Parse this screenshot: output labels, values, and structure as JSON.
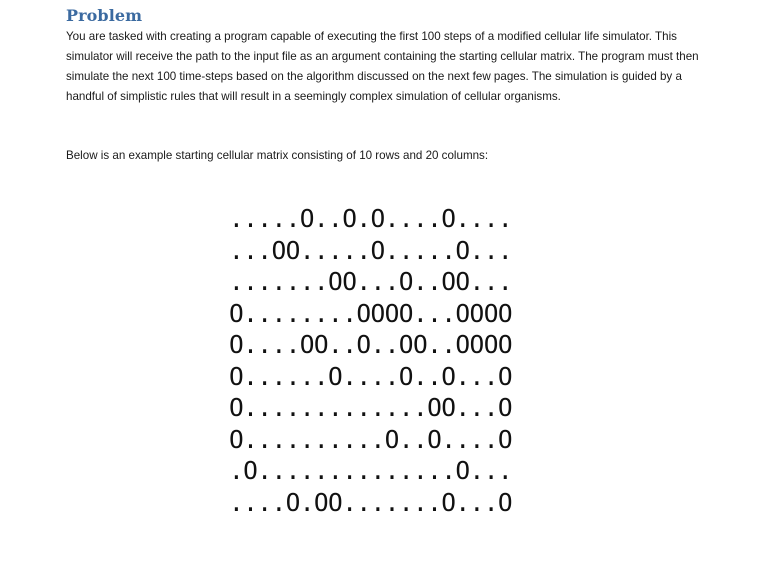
{
  "heading": "Problem",
  "paragraph1": "You are tasked with creating a program capable of executing the first 100 steps of a modified cellular life simulator.  This simulator will receive the path to the input file as an argument containing the starting cellular matrix.  The program must then simulate the next 100 time-steps based on the algorithm discussed on the next few pages.  The simulation is guided by a handful of simplistic rules that will result in a seemingly complex simulation of cellular organisms.",
  "paragraph2": "Below is an example starting cellular matrix consisting of 10 rows and 20 columns:",
  "matrix": {
    "rows": [
      ".....O..O.O....O....",
      "...OO.....O.....O...",
      ".......OO...O..OO...",
      "O........OOOO...OOOO",
      "O....OO..O..OO..OOOO",
      "O......O....O..O...O",
      "O.............OO...O",
      "O..........O..O....O",
      ".O..............O...",
      "....O.OO.......O...O"
    ]
  }
}
